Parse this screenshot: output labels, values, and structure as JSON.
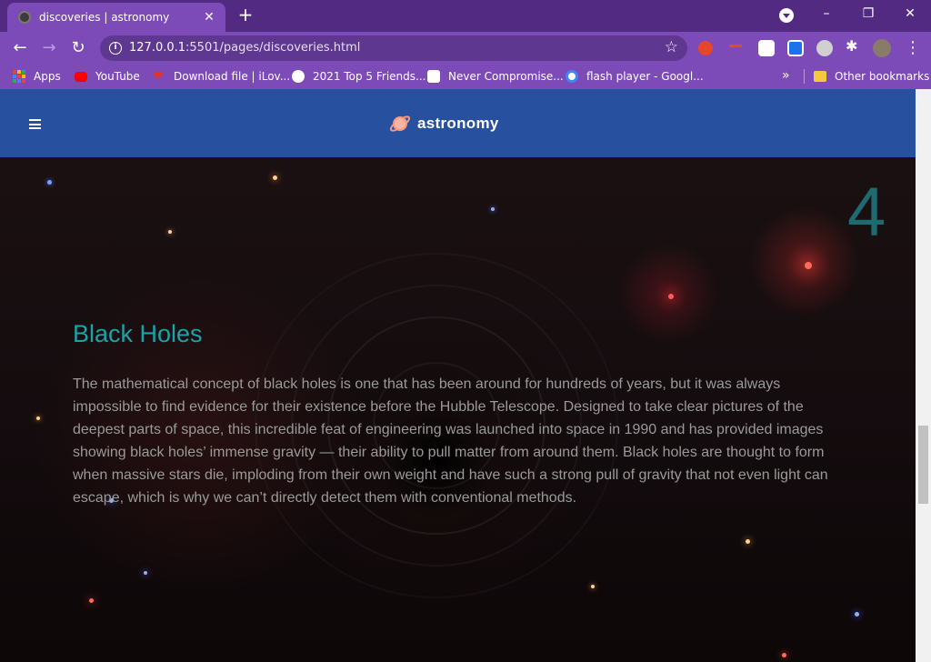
{
  "browser": {
    "tab_title": "discoveries | astronomy",
    "url_host": "127.0.0.1",
    "url_path": ":5501/pages/discoveries.html",
    "bookmarks": [
      {
        "label": "Apps"
      },
      {
        "label": "YouTube"
      },
      {
        "label": "Download file | iLov..."
      },
      {
        "label": "2021 Top 5 Friends..."
      },
      {
        "label": "Never Compromise..."
      },
      {
        "label": "flash player - Googl..."
      }
    ],
    "other_bookmarks": "Other bookmarks",
    "colors": {
      "frame": "#532a82",
      "toolbar": "#7d4bb7"
    }
  },
  "site": {
    "brand": "astronomy",
    "header_color": "#27509f"
  },
  "section": {
    "number": "4",
    "title": "Black Holes",
    "body": "The mathematical concept of black holes is one that has been around for hundreds of years, but it was always impossible to find evidence for their existence before the Hubble Telescope. Designed to take clear pictures of the deepest parts of space, this incredible feat of engineering was launched into space in 1990 and has provided images showing black holes’ immense gravity — their ability to pull matter from around them. Black holes are thought to form when massive stars die, imploding from their own weight and have such a strong pull of gravity that not even light can escape, which is why we can’t directly detect them with conventional methods.",
    "title_color": "#1aa3a8"
  }
}
